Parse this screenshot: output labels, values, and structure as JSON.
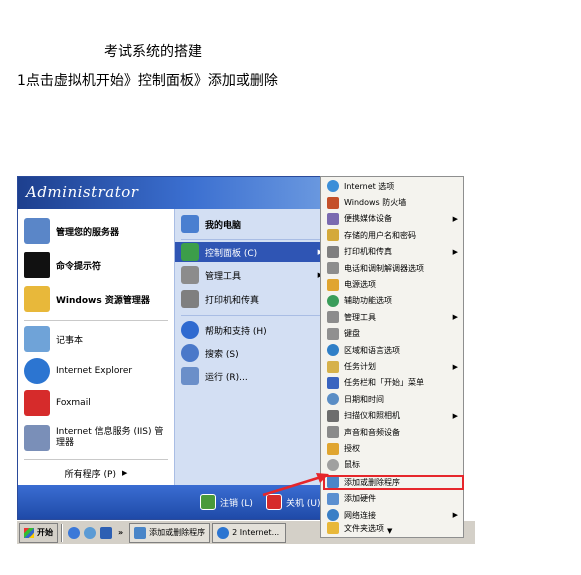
{
  "document": {
    "title": "考试系统的搭建",
    "step": "1点击虚拟机开始》控制面板》添加或删除"
  },
  "start_menu": {
    "user": "Administrator",
    "left_items": [
      {
        "label": "管理您的服务器",
        "icon": "server-manage-icon",
        "color": "#5a86c8"
      },
      {
        "label": "命令提示符",
        "icon": "command-prompt-icon",
        "color": "#111111"
      },
      {
        "label": "Windows 资源管理器",
        "icon": "explorer-folder-icon",
        "color": "#e8b83a"
      },
      {
        "label": "记事本",
        "icon": "notepad-icon",
        "color": "#6fa3d8"
      },
      {
        "label": "Internet Explorer",
        "icon": "ie-icon",
        "color": "#2c75d1"
      },
      {
        "label": "Foxmail",
        "icon": "foxmail-icon",
        "color": "#d62b2b"
      },
      {
        "label": "Internet 信息服务 (IIS) 管理器",
        "icon": "iis-icon",
        "color": "#7a8fb8"
      }
    ],
    "all_programs": "所有程序 (P)",
    "right_items": [
      {
        "label": "我的电脑",
        "icon": "my-computer-icon",
        "color": "#4a7fd0"
      },
      {
        "label": "控制面板 (C)",
        "icon": "control-panel-icon",
        "color": "#3c9e4a"
      },
      {
        "label": "管理工具",
        "icon": "admin-tools-icon",
        "color": "#8c8c8c"
      },
      {
        "label": "打印机和传真",
        "icon": "printer-icon",
        "color": "#7f7f7f"
      },
      {
        "label": "帮助和支持 (H)",
        "icon": "help-icon",
        "color": "#2f6ad0"
      },
      {
        "label": "搜索 (S)",
        "icon": "search-icon",
        "color": "#4a78c9"
      },
      {
        "label": "运行 (R)...",
        "icon": "run-icon",
        "color": "#6b8fc9"
      }
    ],
    "logoff": "注销 (L)",
    "shutdown": "关机 (U)"
  },
  "taskbar": {
    "start": "开始",
    "tasks": [
      "添加或删除程序",
      "2 Internet..."
    ]
  },
  "control_panel_menu": {
    "items": [
      {
        "label": "Internet 选项",
        "icon": "internet-options-icon",
        "color": "#3b8ed8"
      },
      {
        "label": "Windows 防火墙",
        "icon": "firewall-icon",
        "color": "#c4502a"
      },
      {
        "label": "便携媒体设备",
        "icon": "media-device-icon",
        "color": "#7a6ab0",
        "submenu": true
      },
      {
        "label": "存储的用户名和密码",
        "icon": "credentials-icon",
        "color": "#d4a93a"
      },
      {
        "label": "打印机和传真",
        "icon": "printer-icon",
        "color": "#7f7f7f",
        "submenu": true
      },
      {
        "label": "电话和调制解调器选项",
        "icon": "phone-modem-icon",
        "color": "#8d8d8d"
      },
      {
        "label": "电源选项",
        "icon": "power-options-icon",
        "color": "#e0a530"
      },
      {
        "label": "辅助功能选项",
        "icon": "accessibility-icon",
        "color": "#3a9d5a"
      },
      {
        "label": "管理工具",
        "icon": "admin-tools-icon",
        "color": "#8c8c8c",
        "submenu": true
      },
      {
        "label": "键盘",
        "icon": "keyboard-icon",
        "color": "#909090"
      },
      {
        "label": "区域和语言选项",
        "icon": "region-language-icon",
        "color": "#2f7fc7"
      },
      {
        "label": "任务计划",
        "icon": "scheduled-tasks-icon",
        "color": "#d6b14a",
        "submenu": true
      },
      {
        "label": "任务栏和「开始」菜单",
        "icon": "taskbar-icon",
        "color": "#3a64c0"
      },
      {
        "label": "日期和时间",
        "icon": "datetime-icon",
        "color": "#5a8dc5"
      },
      {
        "label": "扫描仪和照相机",
        "icon": "scanner-icon",
        "color": "#6d6d6d",
        "submenu": true
      },
      {
        "label": "声音和音频设备",
        "icon": "sound-icon",
        "color": "#8a8a8a"
      },
      {
        "label": "授权",
        "icon": "licensing-icon",
        "color": "#e0a530"
      },
      {
        "label": "鼠标",
        "icon": "mouse-icon",
        "color": "#a0a0a0"
      },
      {
        "label": "添加或删除程序",
        "icon": "add-remove-programs-icon",
        "color": "#4a86c8"
      },
      {
        "label": "添加硬件",
        "icon": "add-hardware-icon",
        "color": "#5b8fd0"
      },
      {
        "label": "网络连接",
        "icon": "network-connections-icon",
        "color": "#3a7fc6",
        "submenu": true
      },
      {
        "label": "文件夹选项",
        "icon": "folder-options-icon",
        "color": "#e8b83a"
      }
    ]
  },
  "colors": {
    "header_blue": "#2f55b4",
    "highlight": "#2f55b4",
    "annotation_red": "#e6262b"
  }
}
